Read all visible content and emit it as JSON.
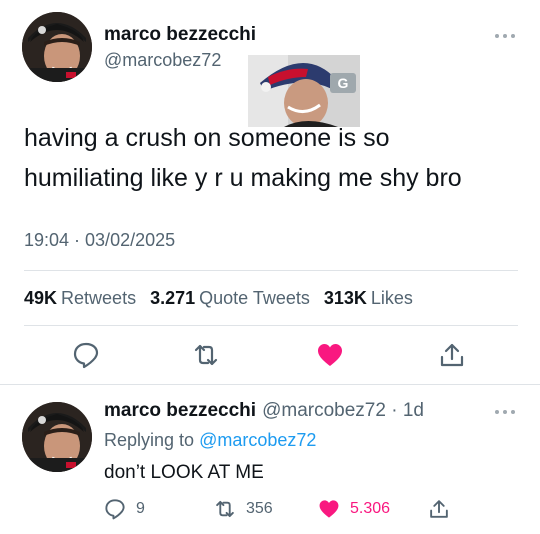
{
  "tweet": {
    "author_name": "marco bezzecchi",
    "author_handle": "@marcobez72",
    "text_line1": "having a crush on someone is so",
    "text_line2": "humiliating like y r u making me shy bro",
    "timestamp": "19:04 · 03/02/2025",
    "stats": {
      "retweets_count": "49K",
      "retweets_label": "Retweets",
      "quotes_count": "3.271",
      "quotes_label": "Quote Tweets",
      "likes_count": "313K",
      "likes_label": "Likes"
    },
    "actions": [
      "reply-icon",
      "retweet-icon",
      "heart-icon",
      "share-icon"
    ],
    "like_color": "#f91880"
  },
  "reply": {
    "author_name": "marco bezzecchi",
    "author_handle": "@marcobez72",
    "separator": "·",
    "age": "1d",
    "replying_label": "Replying to",
    "replying_to": "@marcobez72",
    "text": "don’t LOOK AT ME",
    "counts": {
      "replies": "9",
      "retweets": "356",
      "likes": "5.306"
    }
  },
  "colors": {
    "text": "#0f1419",
    "secondary": "#536471",
    "link": "#1d9bf0",
    "like": "#f91880",
    "divider": "#dfe3e7"
  }
}
